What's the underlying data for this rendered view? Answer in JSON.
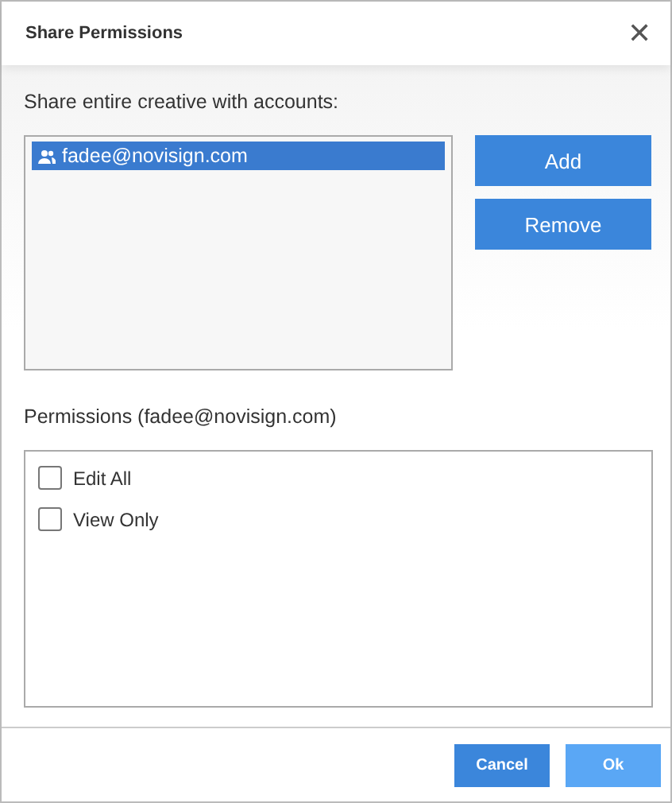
{
  "window": {
    "title": "Share Permissions",
    "close": "✕"
  },
  "accounts": {
    "label": "Share entire creative with accounts:",
    "items": [
      {
        "email": "fadee@novisign.com",
        "selected": true
      }
    ]
  },
  "account_buttons": [
    {
      "label": "Add"
    },
    {
      "label": "Remove"
    }
  ],
  "permissions": {
    "label": "Permissions (fadee@novisign.com)",
    "options": [
      {
        "label": "Edit All",
        "checked": false
      },
      {
        "label": "View Only",
        "checked": false
      }
    ]
  },
  "footer": [
    {
      "label": "Cancel",
      "disabled": false
    },
    {
      "label": "Ok",
      "disabled": true
    }
  ]
}
